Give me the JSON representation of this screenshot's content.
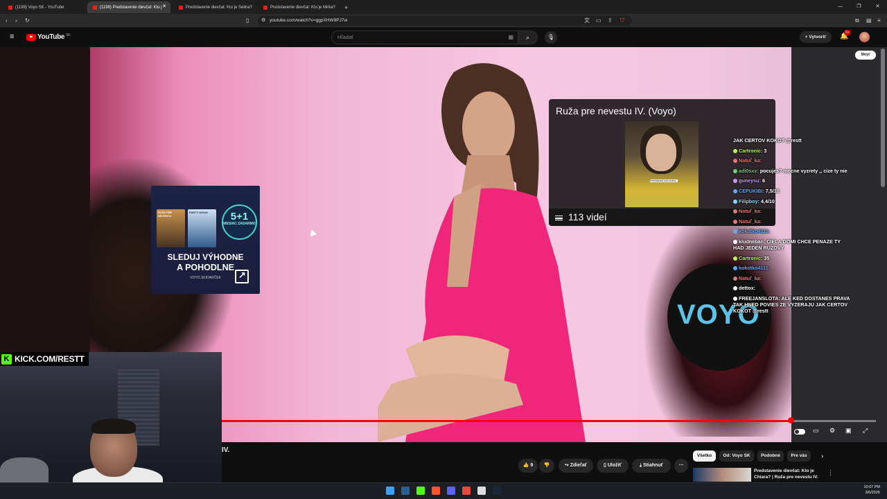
{
  "browser": {
    "tabs": [
      {
        "label": "(1198) Voyo SK - YouTube",
        "active": false
      },
      {
        "label": "(1198) Predstavenie dievčat: Kto j",
        "active": true
      },
      {
        "label": "Predstavenie dievčat: Kto je Selina?",
        "active": false
      },
      {
        "label": "Predstavenie dievčat: Kto je Mirka?",
        "active": false
      }
    ],
    "url": "youtube.com/watch?v=ggpXHW9PJ7w"
  },
  "youtube": {
    "logo": "YouTube",
    "region": "SK",
    "search_placeholder": "Hľadať",
    "create_label": "Vytvoriť",
    "notification_count": "9+"
  },
  "video": {
    "hide_label": "Skryť",
    "progress_fraction": 0.87,
    "ad": {
      "badge_big": "5+1",
      "badge_small": "MESIAC ZADARMO",
      "poster1": "RUŽA PRE NEVESTU",
      "poster2": "PARTY SHOW",
      "line1": "SLEDUJ VÝHODNE",
      "line2": "A POHODLNE",
      "url": "VOYO.SK/DARČEK"
    },
    "playlist": {
      "title": "Ruža pre nevestu IV. (Voyo)",
      "count": "113 videí",
      "caption": "Prednášaná ruža znáva..."
    },
    "voyo_logo": "VOYO"
  },
  "chat": [
    {
      "user": "",
      "text": "JAK CERTOV KOKOT @restt",
      "color": "#ffffff"
    },
    {
      "user": "Cartronic:",
      "text": "3",
      "color": "#b8f55b"
    },
    {
      "user": "Natuľ_ka:",
      "text": "",
      "color": "#e07a7a"
    },
    {
      "user": "adi0sxx:",
      "text": "pocujes? mocne vyzrety ,, cize ty nie",
      "color": "#6cd16c"
    },
    {
      "user": "guneysu:",
      "text": "6",
      "color": "#c89df0"
    },
    {
      "user": "CEPUKIBI:",
      "text": "7,5/10",
      "color": "#5fa8f7"
    },
    {
      "user": "Filipboy:",
      "text": "4,4/10",
      "color": "#8fd7ff"
    },
    {
      "user": "Natuľ_ka:",
      "text": "",
      "color": "#e07a7a"
    },
    {
      "user": "Natuľ_ka:",
      "text": "",
      "color": "#e07a7a"
    },
    {
      "user": "kokotko4111:",
      "text": "",
      "color": "#5fa8f7"
    },
    {
      "user": "kludneban:",
      "text": "CIELA DOMI CHCE PENAZE TY HAD JEDEN RUZOVY",
      "color": "#ffffff"
    },
    {
      "user": "Cartronic:",
      "text": "35",
      "color": "#b8f55b"
    },
    {
      "user": "kokotko4111:",
      "text": "",
      "color": "#5fa8f7"
    },
    {
      "user": "Natuľ_ka:",
      "text": "",
      "color": "#e07a7a"
    },
    {
      "user": "dettox:",
      "text": "",
      "color": "#ffffff"
    },
    {
      "user": "FREEJANSLOTA:",
      "text": "ALE KED DOSTANES PRAVA TAK HNED POVIES ZE VYZERAJU JAK CERTOV KOKOT @restt",
      "color": "#ffffff"
    }
  ],
  "stream": {
    "kick_label": "KICK.COM/RESTT",
    "kick_logo": "K"
  },
  "below": {
    "title_fragment": "IV.",
    "like_count": "9",
    "share_label": "Zdieľať",
    "save_label": "Uložiť",
    "download_label": "Stiahnuť",
    "chips": [
      "Všetko",
      "Od: Voyo SK",
      "Podobné",
      "Pre vás"
    ],
    "rec_title": "Predstavenie dievčat: Kto je Chiara? | Ruža pre nevestu IV."
  },
  "taskbar": {
    "time": "10:07 PM",
    "date": "3/6/2026"
  }
}
